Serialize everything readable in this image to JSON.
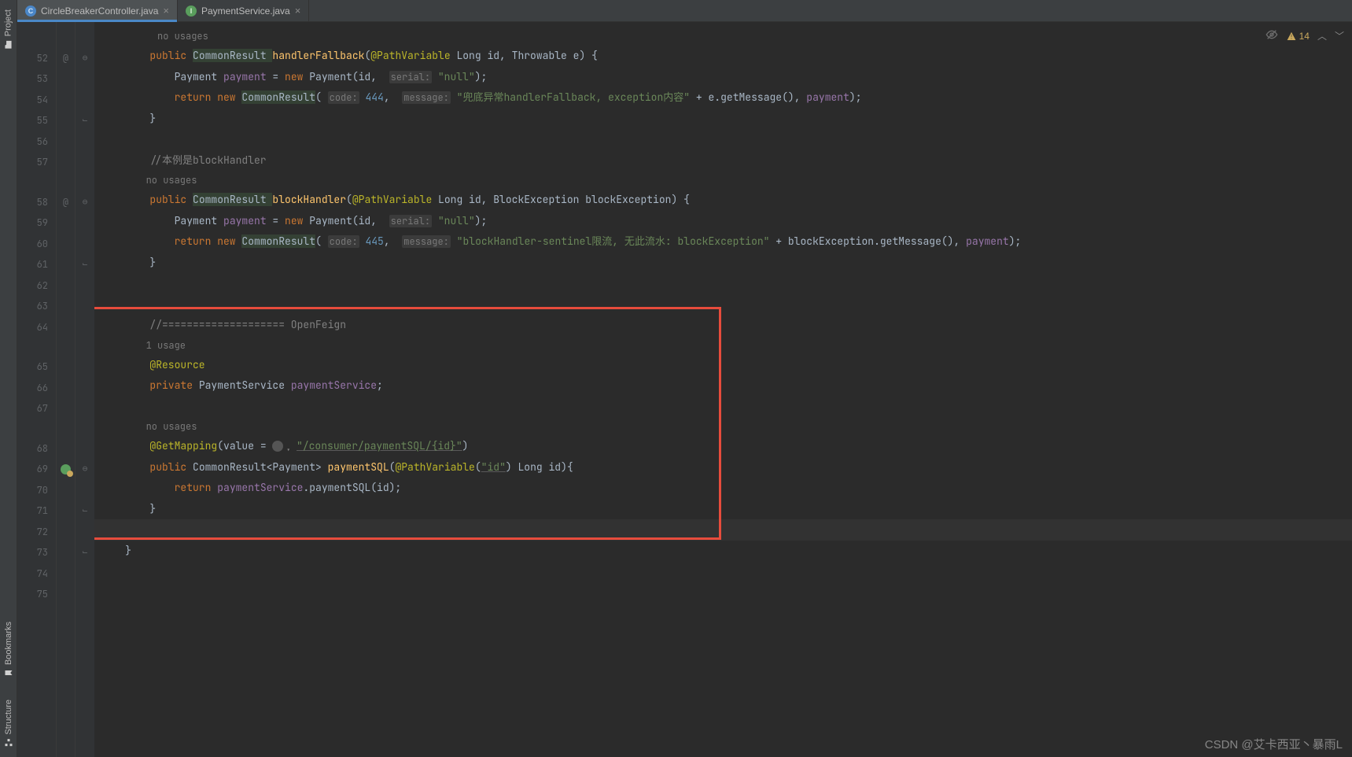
{
  "tabs": [
    {
      "icon": "class",
      "label": "CircleBreakerController.java",
      "active": true
    },
    {
      "icon": "interface",
      "label": "PaymentService.java",
      "active": false
    }
  ],
  "left_tools": {
    "project": "Project",
    "bookmarks": "Bookmarks",
    "structure": "Structure"
  },
  "status": {
    "warn_count": "14"
  },
  "gutter": {
    "start": 52,
    "lines": [
      "52",
      "53",
      "54",
      "55",
      "56",
      "57",
      "",
      "58",
      "59",
      "60",
      "61",
      "62",
      "63",
      "64",
      "",
      "65",
      "66",
      "67",
      "",
      "68",
      "69",
      "70",
      "71",
      "72",
      "73",
      "74",
      "75"
    ],
    "annotation_at": [
      "52",
      "58"
    ],
    "override_icon_at": "69"
  },
  "code": {
    "l_nousages_top": "          no usages",
    "l52": {
      "indent": "        ",
      "kw1": "public ",
      "type": "CommonResult ",
      "fn": "handlerFallback",
      "rest": "(",
      "ann": "@PathVariable ",
      "p1": "Long id, Throwable e) {"
    },
    "l53": {
      "indent": "            ",
      "t": "Payment ",
      "v": "payment ",
      "eq": "= ",
      "kw": "new ",
      "t2": "Payment(id,  ",
      "hint": "serial:",
      "s": " \"null\"",
      "end": ");"
    },
    "l54": {
      "indent": "            ",
      "kw": "return new ",
      "t": "CommonResult",
      "open": "( ",
      "h1": "code:",
      "n": " 444",
      "c": ",  ",
      "h2": "message:",
      "s": " \"兜底异常handlerFallback, exception内容\" ",
      "plus": "+ e.getMessage(), ",
      "v": "payment",
      "end": ");"
    },
    "l55": {
      "indent": "        ",
      "b": "}"
    },
    "l57c": "        //本例是blockHandler",
    "l57h": "        no usages",
    "l58": {
      "indent": "        ",
      "kw1": "public ",
      "type": "CommonResult ",
      "fn": "blockHandler",
      "rest": "(",
      "ann": "@PathVariable ",
      "p1": "Long id, BlockException blockException) {"
    },
    "l59": {
      "indent": "            ",
      "t": "Payment ",
      "v": "payment ",
      "eq": "= ",
      "kw": "new ",
      "t2": "Payment(id,  ",
      "hint": "serial:",
      "s": " \"null\"",
      "end": ");"
    },
    "l60": {
      "indent": "            ",
      "kw": "return new ",
      "t": "CommonResult",
      "open": "( ",
      "h1": "code:",
      "n": " 445",
      "c": ",  ",
      "h2": "message:",
      "s": " \"blockHandler-sentinel限流, 无此流水: blockException\" ",
      "plus": "+ blockException.getMessage(), ",
      "v": "payment",
      "end": ");"
    },
    "l61": {
      "indent": "        ",
      "b": "}"
    },
    "l64": "        //==================== OpenFeign",
    "l64h": "        1 usage",
    "l65": "@Resource",
    "l66": {
      "kw": "private ",
      "t": "PaymentService ",
      "v": "paymentService",
      "end": ";"
    },
    "l67h": "        no usages",
    "l68": {
      "ann": "@GetMapping",
      "open": "(value = ",
      "url": "\"/consumer/paymentSQL/{id}\"",
      "end": ")"
    },
    "l69": {
      "kw": "public ",
      "t": "CommonResult<Payment> ",
      "fn": "paymentSQL",
      "open": "(",
      "ann": "@PathVariable",
      "p": "(",
      "s": "\"id\"",
      "p2": ") Long id){"
    },
    "l70": {
      "kw": "return ",
      "v": "paymentService",
      "call": ".paymentSQL(id);"
    },
    "l71": "        }",
    "l73": "    }"
  },
  "watermark": "CSDN @艾卡西亚丶暴雨L"
}
